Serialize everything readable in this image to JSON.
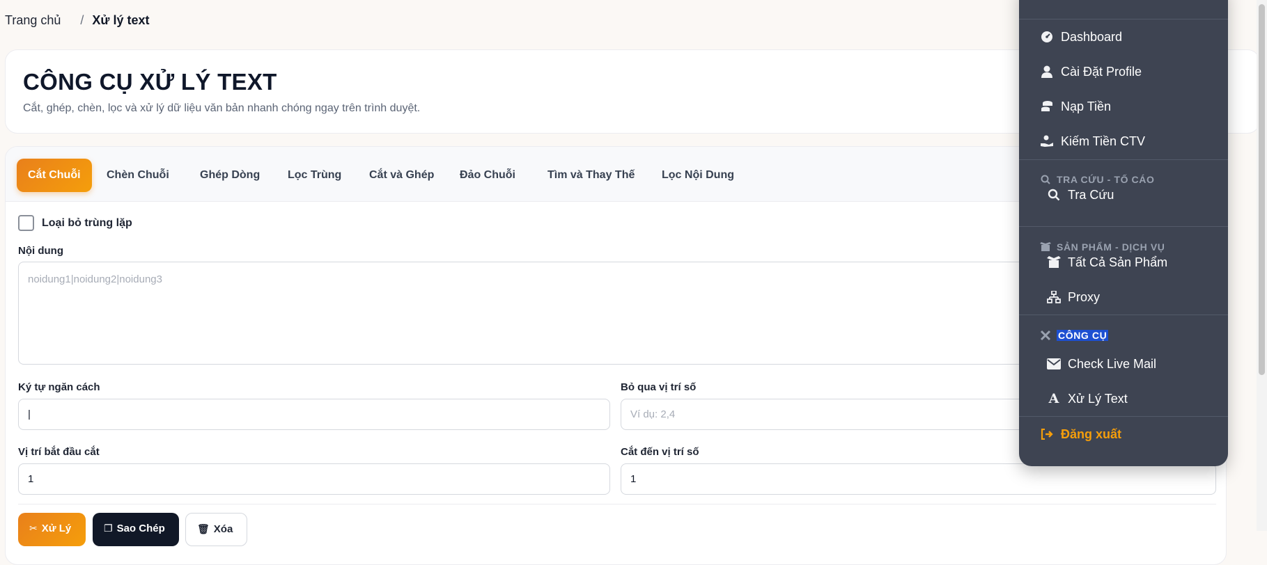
{
  "breadcrumb": {
    "home": "Trang chủ",
    "separator": "/",
    "current": "Xử lý text"
  },
  "header": {
    "title": "CÔNG CỤ XỬ LÝ TEXT",
    "subtitle": "Cắt, ghép, chèn, lọc và xử lý dữ liệu văn bản nhanh chóng ngay trên trình duyệt."
  },
  "tabs": [
    {
      "label": "Cắt Chuỗi",
      "active": true
    },
    {
      "label": "Chèn Chuỗi"
    },
    {
      "label": "Ghép Dòng"
    },
    {
      "label": "Lọc Trùng"
    },
    {
      "label": "Cắt và Ghép"
    },
    {
      "label": "Đảo Chuỗi"
    },
    {
      "label": "Tìm và Thay Thế"
    },
    {
      "label": "Lọc Nội Dung"
    }
  ],
  "form": {
    "dedupe_label": "Loại bỏ trùng lặp",
    "dedupe_checked": false,
    "content_label": "Nội dung",
    "content_placeholder": "noidung1|noidung2|noidung3",
    "separator_label": "Ký tự ngăn cách",
    "separator_value": "|",
    "skip_label": "Bỏ qua vị trí số",
    "skip_placeholder": "Ví dụ: 2,4",
    "start_label": "Vị trí bắt đầu cắt",
    "start_value": "1",
    "end_label": "Cắt đến vị trí số",
    "end_value": "1"
  },
  "buttons": {
    "process": "Xử Lý",
    "copy": "Sao Chép",
    "clear": "Xóa"
  },
  "menu": {
    "items_main": [
      {
        "label": "Dashboard",
        "icon": "gauge-icon"
      },
      {
        "label": "Cài Đặt Profile",
        "icon": "user-icon"
      },
      {
        "label": "Nạp Tiền",
        "icon": "coins-icon"
      },
      {
        "label": "Kiếm Tiền CTV",
        "icon": "hand-coin-icon"
      }
    ],
    "section_lookup": "TRA CỨU - TỐ CÁO",
    "lookup_items": [
      {
        "label": "Tra Cứu",
        "icon": "search-icon"
      }
    ],
    "section_products": "SẢN PHẨM - DỊCH VỤ",
    "product_items": [
      {
        "label": "Tất Cả Sản Phẩm",
        "icon": "box-open-icon"
      },
      {
        "label": "Proxy",
        "icon": "network-icon"
      }
    ],
    "section_tools": "CÔNG CỤ",
    "tool_items": [
      {
        "label": "Check Live Mail",
        "icon": "envelope-icon"
      },
      {
        "label": "Xử Lý Text",
        "icon": "font-icon"
      }
    ],
    "logout": "Đăng xuất"
  },
  "colors": {
    "accent": "#f08c1e",
    "menu_bg": "#3e4452",
    "dark_button": "#111827",
    "highlight": "#1c4fd1"
  }
}
